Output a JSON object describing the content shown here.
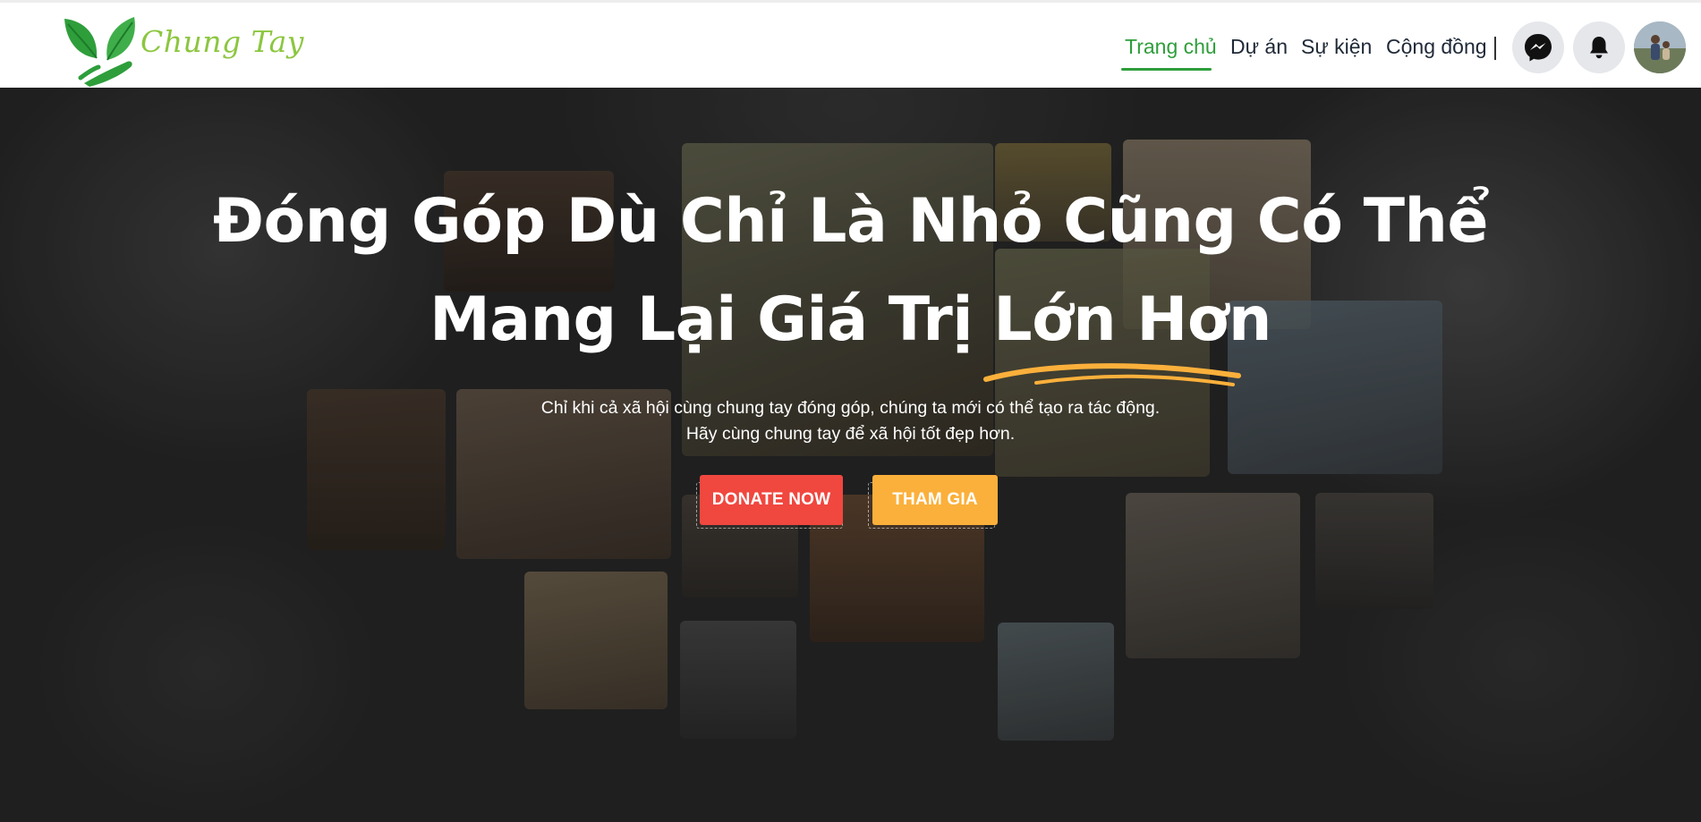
{
  "header": {
    "logo_text": "Chung Tay",
    "nav": [
      {
        "label": "Trang chủ",
        "active": true
      },
      {
        "label": "Dự án",
        "active": false
      },
      {
        "label": "Sự kiện",
        "active": false
      },
      {
        "label": "Cộng đồng",
        "active": false
      }
    ],
    "icons": [
      "messenger-icon",
      "bell-icon"
    ],
    "colors": {
      "active": "#2e9e3b",
      "logo": "#8cc63f"
    }
  },
  "hero": {
    "headline_line1": "Đóng Góp Dù Chỉ Là Nhỏ Cũng Có Thể",
    "headline_line2": "Mang Lại Giá Trị Lớn Hơn",
    "subtext_line1": "Chỉ khi cả xã hội cùng chung tay đóng góp, chúng ta mới có thể tạo ra tác động.",
    "subtext_line2": "Hãy cùng chung tay để xã hội tốt đẹp hơn.",
    "donate_label": "DONATE NOW",
    "join_label": "THAM GIA",
    "colors": {
      "donate": "#f0473f",
      "join": "#fbb03b",
      "underline": "#fbb03b"
    }
  }
}
